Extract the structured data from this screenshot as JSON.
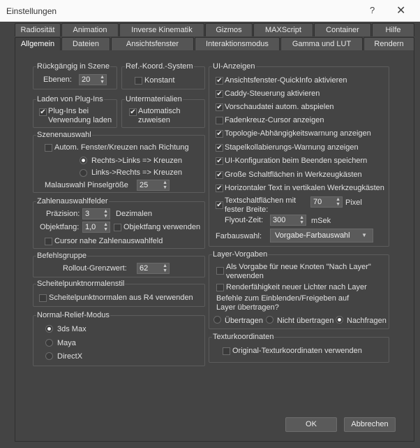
{
  "window": {
    "title": "Einstellungen",
    "help": "?",
    "close": "✕"
  },
  "tabs_row1": [
    "Radiosität",
    "Animation",
    "Inverse Kinematik",
    "Gizmos",
    "MAXScript",
    "Container",
    "Hilfe"
  ],
  "tabs_row2": [
    "Allgemein",
    "Dateien",
    "Ansichtsfenster",
    "Interaktionsmodus",
    "Gamma und LUT",
    "Rendern"
  ],
  "undo": {
    "title": "Rückgängig in Szene",
    "levels_label": "Ebenen:",
    "levels_value": "20"
  },
  "refcoord": {
    "title": "Ref.-Koord.-System",
    "constant": "Konstant"
  },
  "plugins": {
    "title": "Laden von Plug-Ins",
    "use_loaded": "Plug-Ins bei Verwendung laden"
  },
  "submaterials": {
    "title": "Untermaterialien",
    "auto_assign": "Automatisch zuweisen"
  },
  "scene_selection": {
    "title": "Szenenauswahl",
    "auto_window": "Autom. Fenster/Kreuzen nach Richtung",
    "right_left": "Rechts->Links => Kreuzen",
    "left_right": "Links->Rechts => Kreuzen",
    "brush_label": "Malauswahl Pinselgröße",
    "brush_value": "25"
  },
  "spinners": {
    "title": "Zahlenauswahlfelder",
    "precision_label": "Präzision:",
    "precision_value": "3",
    "precision_unit": "Dezimalen",
    "snap_label": "Objektfang:",
    "snap_value": "1,0",
    "use_snap": "Objektfang verwenden",
    "cursor_near": "Cursor nahe Zahlenauswahlfeld"
  },
  "command_panel": {
    "title": "Befehlsgruppe",
    "rollout_label": "Rollout-Grenzwert:",
    "rollout_value": "62"
  },
  "vertex_normal": {
    "title": "Scheitelpunktnormalenstil",
    "use_r4": "Scheitelpunktnormalen aus R4 verwenden"
  },
  "normal_bump": {
    "title": "Normal-Relief-Modus",
    "opt_3dsmax": "3ds Max",
    "opt_maya": "Maya",
    "opt_directx": "DirectX"
  },
  "ui": {
    "title": "UI-Anzeigen",
    "items": [
      "Ansichtsfenster-QuickInfo aktivieren",
      "Caddy-Steuerung aktivieren",
      "Vorschaudatei autom. abspielen",
      "Fadenkreuz-Cursor anzeigen",
      "Topologie-Abhängigkeitswarnung anzeigen",
      "Stapelkollabierungs-Warnung anzeigen",
      "UI-Konfiguration beim Beenden speichern",
      "Große Schaltflächen in Werkzeugkästen",
      "Horizontaler Text in vertikalen Werkzeugkästen"
    ],
    "checked": [
      true,
      true,
      true,
      false,
      true,
      true,
      true,
      true,
      true
    ],
    "fixed_width": "Textschaltflächen mit fester Breite:",
    "fixed_width_value": "70",
    "fixed_width_unit": "Pixel",
    "flyout_label": "Flyout-Zeit:",
    "flyout_value": "300",
    "flyout_unit": "mSek",
    "color_label": "Farbauswahl:",
    "color_value": "Vorgabe-Farbauswahl"
  },
  "layer": {
    "title": "Layer-Vorgaben",
    "default_new": "Als Vorgabe für neue Knoten \"Nach Layer\" verwenden",
    "renderability": "Renderfähigkeit neuer Lichter nach Layer",
    "propagate": "Befehle zum Einblenden/Freigeben auf Layer übertragen?",
    "opt_transfer": "Übertragen",
    "opt_no_transfer": "Nicht übertragen",
    "opt_ask": "Nachfragen"
  },
  "texture": {
    "title": "Texturkoordinaten",
    "use_original": "Original-Texturkoordinaten verwenden"
  },
  "buttons": {
    "ok": "OK",
    "cancel": "Abbrechen"
  }
}
